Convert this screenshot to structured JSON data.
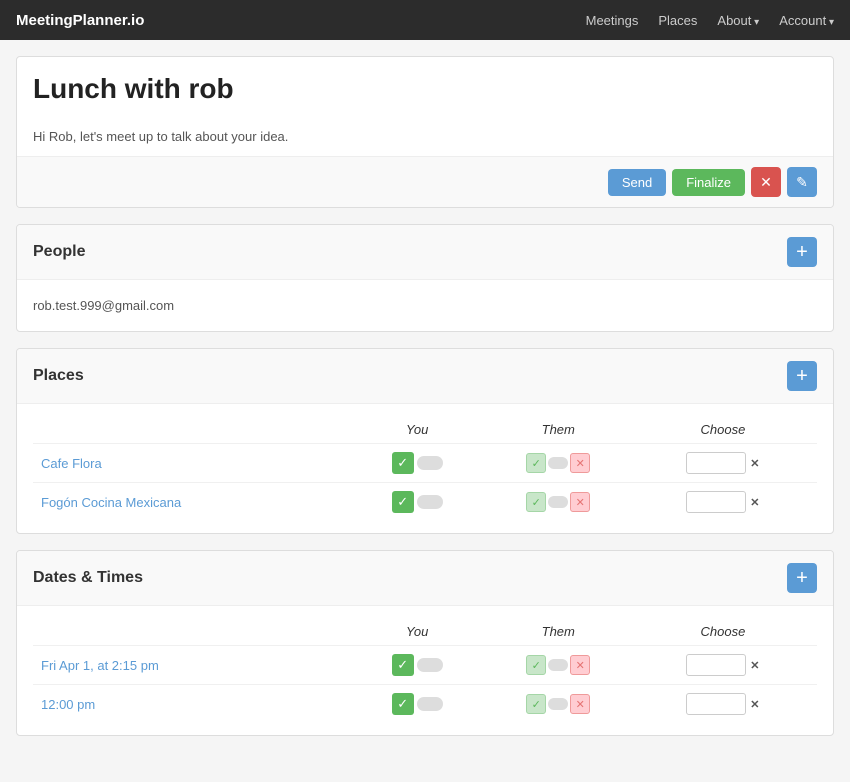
{
  "nav": {
    "brand": "MeetingPlanner.io",
    "links": [
      {
        "label": "Meetings",
        "caret": false
      },
      {
        "label": "Places",
        "caret": false
      },
      {
        "label": "About",
        "caret": true
      },
      {
        "label": "Account",
        "caret": true
      }
    ]
  },
  "meeting": {
    "title": "Lunch with rob",
    "message": "Hi Rob, let's meet up to talk about your idea.",
    "actions": {
      "send": "Send",
      "finalize": "Finalize",
      "delete_icon": "✕",
      "edit_icon": "✎"
    }
  },
  "people": {
    "section_title": "People",
    "add_icon": "+",
    "entries": [
      {
        "email": "rob.test.999@gmail.com"
      }
    ]
  },
  "places": {
    "section_title": "Places",
    "add_icon": "+",
    "col_you": "You",
    "col_them": "Them",
    "col_choose": "Choose",
    "rows": [
      {
        "name": "Cafe Flora"
      },
      {
        "name": "Fogón Cocina Mexicana"
      }
    ]
  },
  "dates": {
    "section_title": "Dates & Times",
    "add_icon": "+",
    "col_you": "You",
    "col_them": "Them",
    "col_choose": "Choose",
    "rows": [
      {
        "label": "Fri Apr 1, at 2:15 pm"
      },
      {
        "label": "12:00 pm"
      }
    ]
  }
}
